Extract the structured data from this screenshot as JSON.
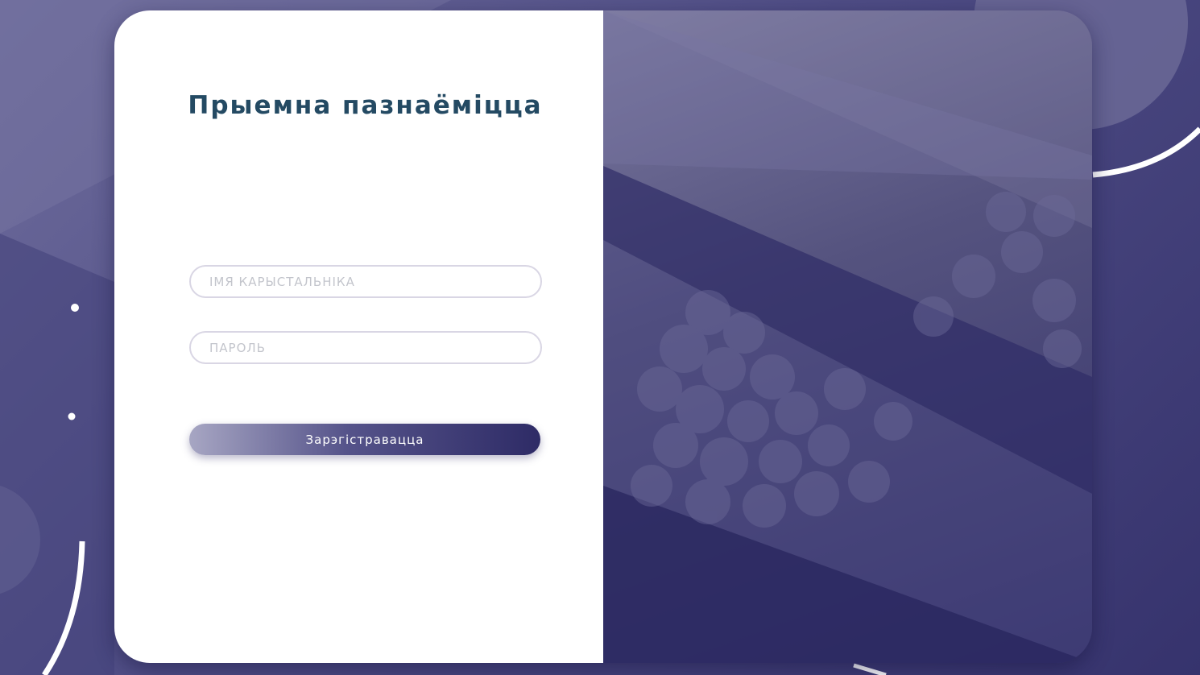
{
  "login": {
    "title": "Прыемна пазнаёміцца",
    "username_placeholder": "ІМЯ КАРЫСТАЛЬНІКА",
    "username_value": "",
    "password_placeholder": "ПАРОЛЬ",
    "password_value": "",
    "submit_label": "Зарэгістравацца"
  },
  "colors": {
    "title": "#244a63",
    "background": "#4f4d85",
    "button_start": "#a7a6c3",
    "button_end": "#2e2b66",
    "field_border": "#d9d6e4"
  }
}
